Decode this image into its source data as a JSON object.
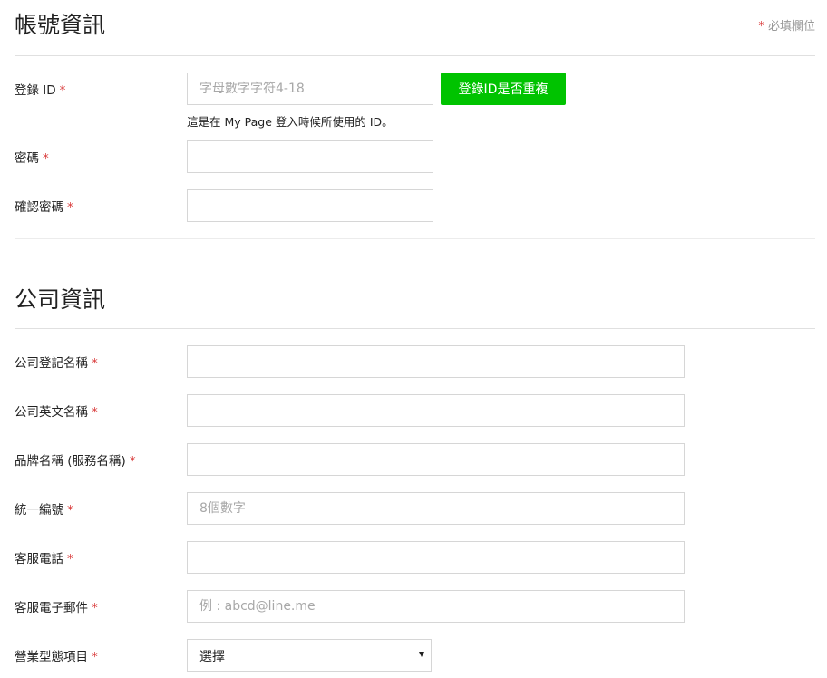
{
  "required_note": {
    "star": "*",
    "text": "必填欄位"
  },
  "account": {
    "title": "帳號資訊",
    "login_id": {
      "label": "登錄 ID",
      "placeholder": "字母數字字符4-18",
      "value": "",
      "check_button": "登錄ID是否重複",
      "help": "這是在 My Page 登入時候所使用的 ID。"
    },
    "password": {
      "label": "密碼",
      "value": ""
    },
    "confirm_password": {
      "label": "確認密碼",
      "value": ""
    }
  },
  "company": {
    "title": "公司資訊",
    "registered_name": {
      "label": "公司登記名稱",
      "value": ""
    },
    "english_name": {
      "label": "公司英文名稱",
      "value": ""
    },
    "brand_name": {
      "label": "品牌名稱 (服務名稱)",
      "value": ""
    },
    "tax_id": {
      "label": "統一編號",
      "placeholder": "8個數字",
      "value": ""
    },
    "service_phone": {
      "label": "客服電話",
      "value": ""
    },
    "service_email": {
      "label": "客服電子郵件",
      "placeholder": "例 : abcd@line.me",
      "value": ""
    },
    "business_type": {
      "label": "營業型態項目",
      "selected": "選擇"
    }
  },
  "required_star": "*"
}
